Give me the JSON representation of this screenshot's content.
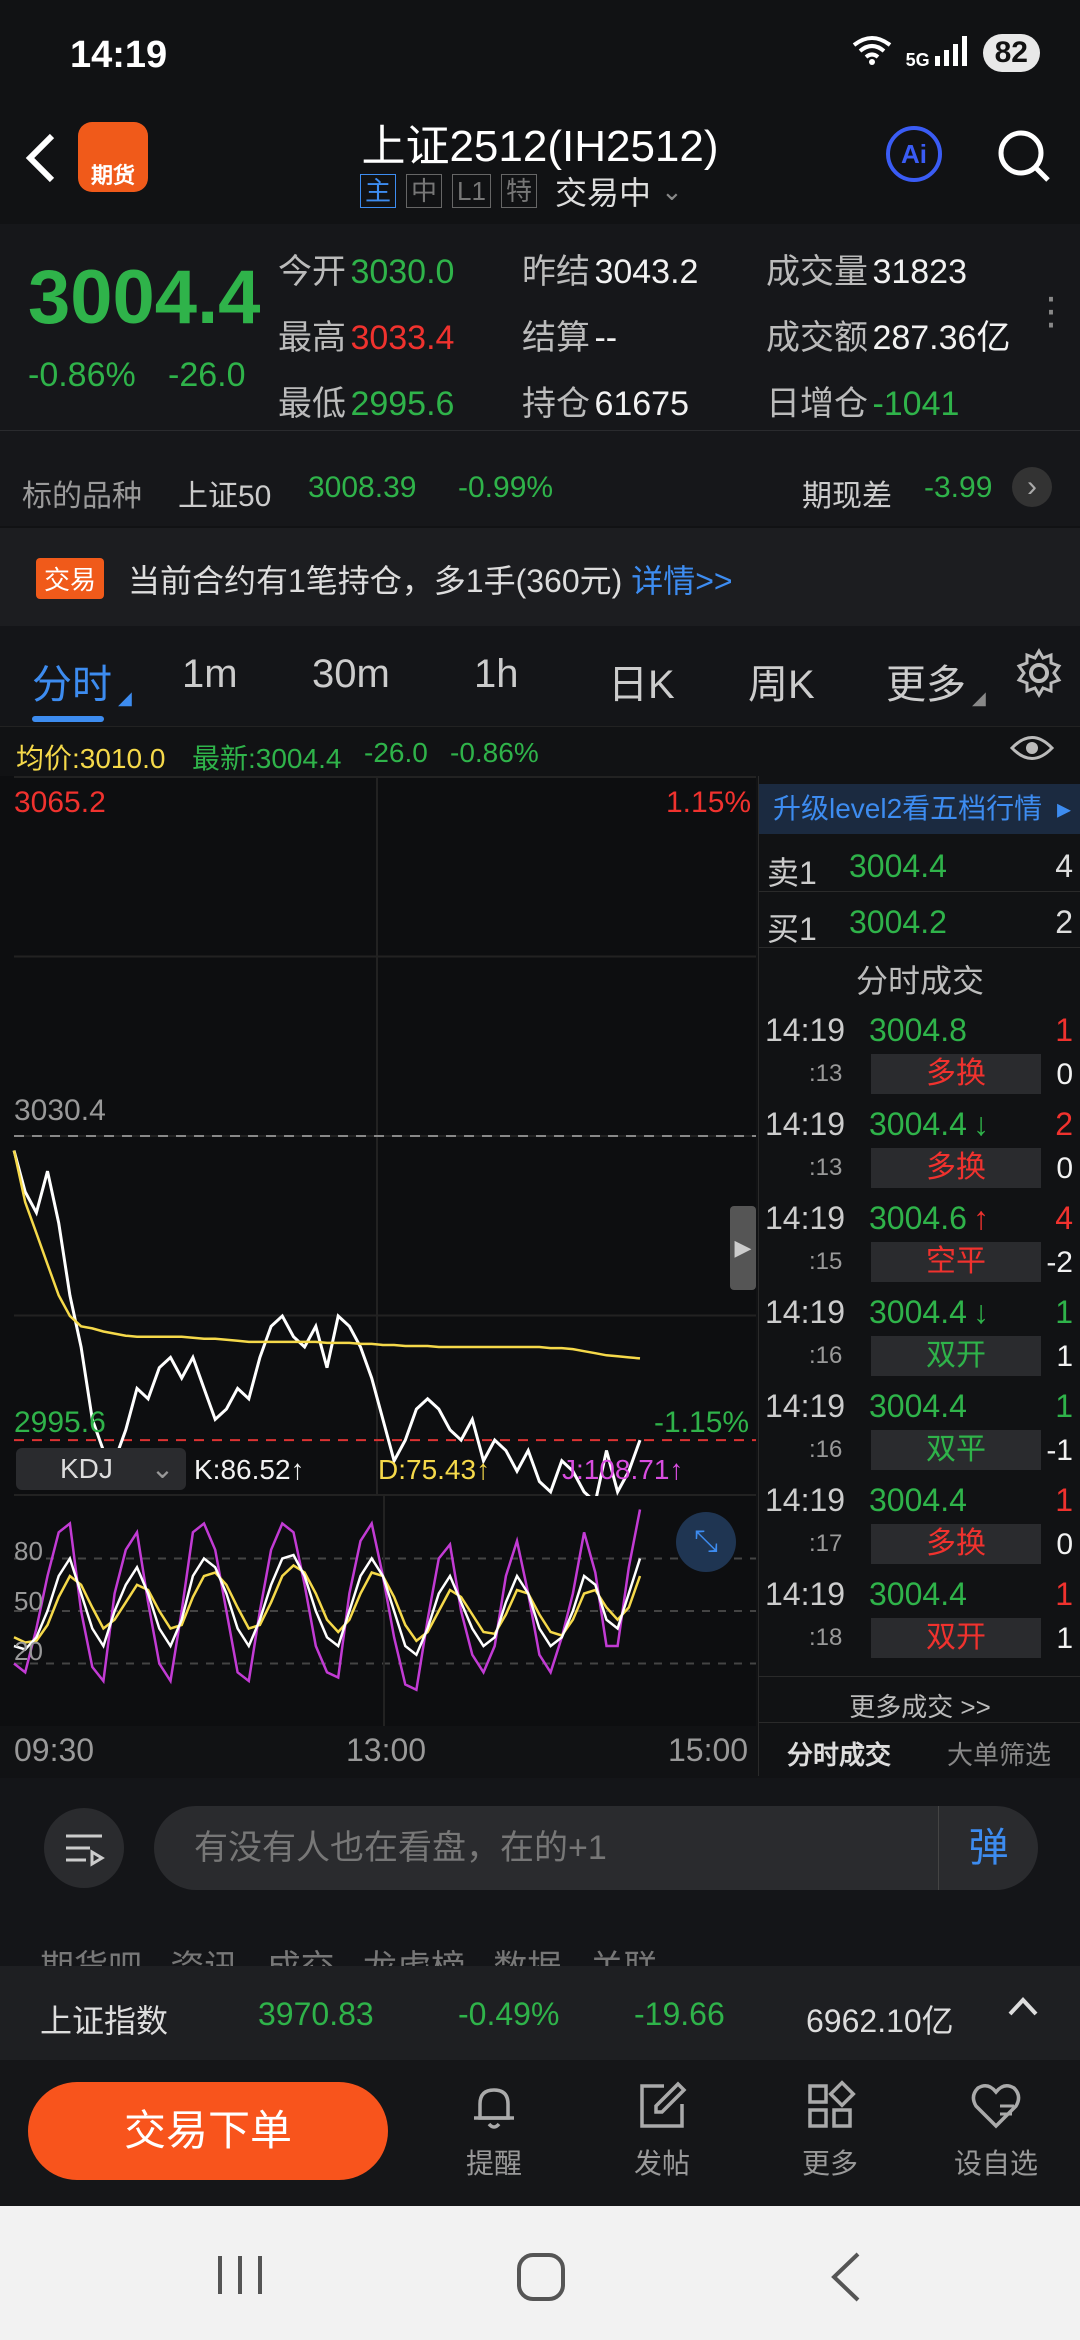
{
  "status": {
    "time": "14:19",
    "signal": "5G",
    "battery": "82"
  },
  "header": {
    "title": "上证2512(IH2512)",
    "tags": [
      "主",
      "中",
      "L1",
      "特"
    ],
    "trade_status": "交易中",
    "logo_text": "期货",
    "ai_label": "Ai"
  },
  "quote": {
    "last_price": "3004.4",
    "change_pct": "-0.86%",
    "change_abs": "-26.0",
    "open_label": "今开",
    "open": "3030.0",
    "prev_settle_label": "昨结",
    "prev_settle": "3043.2",
    "volume_label": "成交量",
    "volume": "31823",
    "high_label": "最高",
    "high": "3033.4",
    "settle_label": "结算",
    "settle": "--",
    "turnover_label": "成交额",
    "turnover": "287.36亿",
    "low_label": "最低",
    "low": "2995.6",
    "oi_label": "持仓",
    "oi": "61675",
    "oi_change_label": "日增仓",
    "oi_change": "-1041"
  },
  "underlying": {
    "label": "标的品种",
    "name": "上证50",
    "price": "3008.39",
    "change": "-0.99%",
    "basis_label": "期现差",
    "basis": "-3.99"
  },
  "position": {
    "badge": "交易",
    "text": "当前合约有1笔持仓，多1手(360元)",
    "link": "详情>>"
  },
  "tabs": [
    "分时",
    "1m",
    "30m",
    "1h",
    "日K",
    "周K",
    "更多"
  ],
  "avg_row": {
    "avg": "均价:3010.0",
    "latest": "最新:3004.4",
    "chg": "-26.0",
    "pct": "-0.86%"
  },
  "chart_labels": {
    "y_top": "3065.2",
    "y_top_pct": "1.15%",
    "y_mid": "3030.4",
    "y_bottom": "2995.6",
    "y_bottom_pct": "-1.15%",
    "kdj_select": "KDJ",
    "k": "K:86.52↑",
    "d": "D:75.43↑",
    "j": "J:108.71↑",
    "kdj_levels": [
      "80",
      "50",
      "20"
    ],
    "time_start": "09:30",
    "time_mid": "13:00",
    "time_end": "15:00"
  },
  "chart_data": {
    "type": "line",
    "series": [
      {
        "name": "price",
        "color": "#ffffff",
        "values": [
          3029,
          3025,
          3023,
          3027,
          3022,
          3015,
          3010,
          3003,
          3000,
          2999,
          3002,
          3006,
          3005,
          3008,
          3009,
          3007,
          3009,
          3006,
          3003,
          3004,
          3006,
          3005,
          3009,
          3012,
          3013,
          3011,
          3010,
          3012,
          3008,
          3013,
          3012,
          3010,
          3007,
          3003,
          2999,
          3001,
          3004,
          3005,
          3004,
          3002,
          3001,
          3003,
          2999,
          3001,
          3000,
          2998,
          3000,
          2997,
          2996,
          2999,
          2998,
          2996,
          2995,
          3000,
          2996,
          2998,
          3001
        ]
      },
      {
        "name": "avg",
        "color": "#f5d94a",
        "values": [
          3029,
          3024,
          3021,
          3018,
          3015,
          3013,
          3012,
          3011.8,
          3011.5,
          3011.3,
          3011.1,
          3011,
          3011,
          3011,
          3011,
          3011,
          3010.9,
          3010.8,
          3010.8,
          3010.7,
          3010.6,
          3010.5,
          3010.5,
          3010.5,
          3010.5,
          3010.5,
          3010.5,
          3010.5,
          3010.4,
          3010.4,
          3010.4,
          3010.3,
          3010.3,
          3010.2,
          3010.2,
          3010.1,
          3010.1,
          3010.1,
          3010,
          3010,
          3010,
          3010,
          3010,
          3010,
          3010,
          3010,
          3010,
          3010,
          3009.9,
          3009.9,
          3009.8,
          3009.6,
          3009.4,
          3009.2,
          3009.1,
          3009,
          3008.9
        ]
      }
    ],
    "ylim": [
      2995.6,
      3065.2
    ],
    "ref_price": 3030.4,
    "dashed_price": 3001.0,
    "kdj": {
      "k": [
        30,
        28,
        35,
        50,
        70,
        80,
        60,
        40,
        30,
        50,
        65,
        75,
        60,
        40,
        30,
        45,
        70,
        80,
        75,
        60,
        40,
        30,
        45,
        65,
        80,
        82,
        70,
        50,
        35,
        30,
        50,
        70,
        80,
        70,
        50,
        30,
        25,
        40,
        60,
        70,
        55,
        40,
        30,
        35,
        55,
        70,
        60,
        40,
        30,
        35,
        50,
        70,
        65,
        45,
        40,
        60,
        80
      ],
      "d": [
        35,
        32,
        33,
        42,
        58,
        70,
        65,
        52,
        40,
        45,
        55,
        65,
        62,
        50,
        40,
        42,
        58,
        70,
        72,
        65,
        52,
        40,
        42,
        55,
        70,
        76,
        72,
        60,
        45,
        38,
        45,
        60,
        72,
        70,
        58,
        42,
        33,
        38,
        50,
        62,
        58,
        48,
        38,
        37,
        48,
        62,
        60,
        48,
        38,
        36,
        45,
        60,
        62,
        52,
        45,
        52,
        70
      ],
      "j": [
        20,
        15,
        40,
        70,
        95,
        100,
        50,
        18,
        10,
        60,
        85,
        95,
        55,
        20,
        10,
        50,
        95,
        100,
        85,
        50,
        15,
        10,
        50,
        85,
        100,
        95,
        65,
        30,
        15,
        12,
        60,
        90,
        100,
        70,
        35,
        8,
        5,
        45,
        80,
        88,
        50,
        25,
        15,
        30,
        70,
        90,
        60,
        25,
        15,
        35,
        60,
        95,
        72,
        30,
        30,
        75,
        108
      ]
    }
  },
  "level2_banner": "升级level2看五档行情",
  "order_book": [
    {
      "side": "卖1",
      "price": "3004.4",
      "qty": "4"
    },
    {
      "side": "买1",
      "price": "3004.2",
      "qty": "2"
    }
  ],
  "ticks_title": "分时成交",
  "ticks": [
    {
      "time": "14:19",
      "price": "3004.8",
      "arrow": "",
      "vol": "1",
      "sec": ":13",
      "type": "多换",
      "oi": "0",
      "type_color": "red"
    },
    {
      "time": "14:19",
      "price": "3004.4",
      "arrow": "↓",
      "vol": "2",
      "sec": ":13",
      "type": "多换",
      "oi": "0",
      "type_color": "red"
    },
    {
      "time": "14:19",
      "price": "3004.6",
      "arrow": "↑",
      "vol": "4",
      "sec": ":15",
      "type": "空平",
      "oi": "-2",
      "type_color": "red"
    },
    {
      "time": "14:19",
      "price": "3004.4",
      "arrow": "↓",
      "vol": "1",
      "sec": ":16",
      "type": "双开",
      "oi": "1",
      "type_color": "green"
    },
    {
      "time": "14:19",
      "price": "3004.4",
      "arrow": "",
      "vol": "1",
      "sec": ":16",
      "type": "双平",
      "oi": "-1",
      "type_color": "green"
    },
    {
      "time": "14:19",
      "price": "3004.4",
      "arrow": "",
      "vol": "1",
      "sec": ":17",
      "type": "多换",
      "oi": "0",
      "type_color": "red"
    },
    {
      "time": "14:19",
      "price": "3004.4",
      "arrow": "",
      "vol": "1",
      "sec": ":18",
      "type": "双开",
      "oi": "1",
      "type_color": "red"
    }
  ],
  "ticks_more": "更多成交 >>",
  "ticks_tabs": [
    "分时成交",
    "大单筛选"
  ],
  "comment": {
    "placeholder": "有没有人也在看盘，在的+1",
    "danmu": "弹"
  },
  "subtabs_peek": "期货吧   资讯   成交   龙虎榜   数据   关联",
  "index_bar": {
    "name": "上证指数",
    "price": "3970.83",
    "pct": "-0.49%",
    "chg": "-19.66",
    "turnover": "6962.10亿"
  },
  "toolbar": {
    "order": "交易下单",
    "remind": "提醒",
    "post": "发帖",
    "more": "更多",
    "watch": "设自选"
  }
}
